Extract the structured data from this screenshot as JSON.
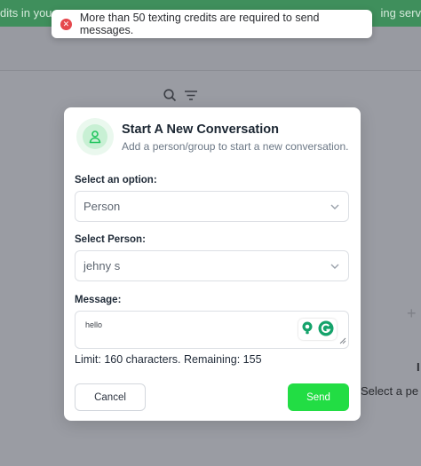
{
  "background": {
    "banner_left": "dits in you",
    "banner_right": "ing serv",
    "select_prompt": "Select a pe",
    "bold_fragment": "I",
    "plus": "+"
  },
  "toast": {
    "message": "More than 50 texting credits are required to send messages.",
    "icon": "error-x-icon"
  },
  "modal": {
    "title": "Start A New Conversation",
    "subtitle": "Add a person/group to start a new conversation.",
    "option_label": "Select an option:",
    "option_value": "Person",
    "person_label": "Select Person:",
    "person_value": "jehny s",
    "message_label": "Message:",
    "message_value": "hello",
    "limit_text": "Limit: 160 characters. Remaining: 155",
    "cancel_label": "Cancel",
    "send_label": "Send"
  },
  "colors": {
    "accent": "#22dd44",
    "error": "#e5484d",
    "banner": "#3f8f5c"
  }
}
